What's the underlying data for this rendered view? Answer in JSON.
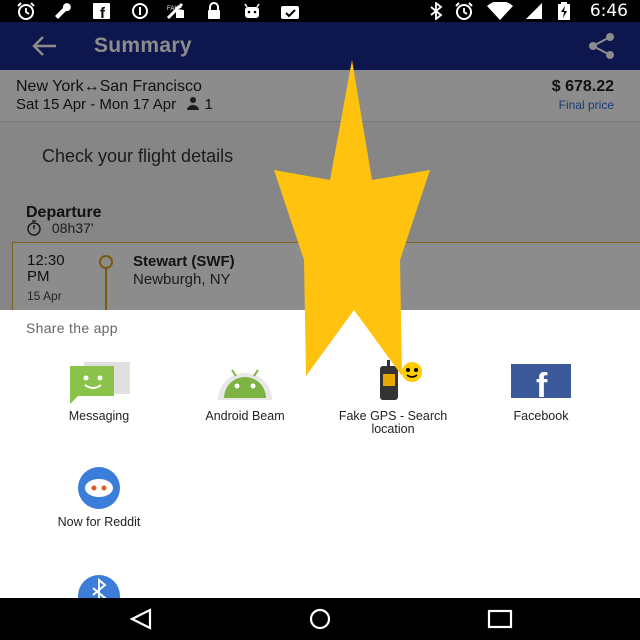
{
  "status_bar": {
    "time": "6:46",
    "left_icons": [
      "alarm-icon",
      "wrench-icon",
      "facebook-icon",
      "data-saver-icon",
      "fake-gps-icon",
      "lock-icon",
      "android-debug-icon",
      "task-icon"
    ],
    "right_icons": [
      "bluetooth-icon",
      "alarm-icon",
      "wifi-icon",
      "battery-charging-icon"
    ]
  },
  "toolbar": {
    "title": "Summary",
    "back_icon": "arrow-back-icon",
    "share_icon": "share-icon",
    "color": "#1a2a8c"
  },
  "trip": {
    "route": "New York↔San Francisco",
    "dates": "Sat 15 Apr - Mon 17 Apr",
    "passengers": "1",
    "price": "$ 678.22",
    "price_note": "Final price"
  },
  "details": {
    "check_text": "Check your flight details",
    "departure_label": "Departure",
    "duration": "08h37'",
    "segment": {
      "time": "12:30 PM",
      "date": "15 Apr",
      "airport": "Stewart (SWF)",
      "city": "Newburgh, NY"
    }
  },
  "share_sheet": {
    "title": "Share the app",
    "apps": [
      {
        "label": "Messaging",
        "icon": "messaging-icon"
      },
      {
        "label": "Android Beam",
        "icon": "android-beam-icon"
      },
      {
        "label": "Fake GPS - Search location",
        "icon": "fake-gps-app-icon"
      },
      {
        "label": "Facebook",
        "icon": "facebook-app-icon"
      },
      {
        "label": "Now for Reddit",
        "icon": "reddit-app-icon"
      },
      {
        "label": "",
        "icon": "bluetooth-app-icon"
      }
    ]
  },
  "nav_bar": {
    "buttons": [
      "back-nav-icon",
      "home-nav-icon",
      "recents-nav-icon"
    ]
  },
  "overlay": {
    "shape": "star",
    "color": "#ffc20e"
  }
}
